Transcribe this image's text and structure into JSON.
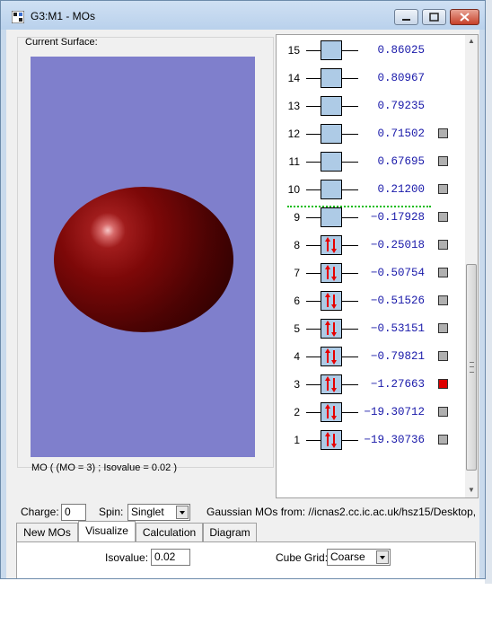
{
  "window": {
    "title": "G3:M1 - MOs"
  },
  "surface": {
    "label": "Current Surface:",
    "status": "MO ( (MO = 3) ; Isovalue = 0.02 )"
  },
  "orbitals": [
    {
      "num": "15",
      "energy": "0.86025",
      "occupied": false,
      "checkbox": false,
      "selected": false
    },
    {
      "num": "14",
      "energy": "0.80967",
      "occupied": false,
      "checkbox": false,
      "selected": false
    },
    {
      "num": "13",
      "energy": "0.79235",
      "occupied": false,
      "checkbox": false,
      "selected": false
    },
    {
      "num": "12",
      "energy": "0.71502",
      "occupied": false,
      "checkbox": true,
      "selected": false
    },
    {
      "num": "11",
      "energy": "0.67695",
      "occupied": false,
      "checkbox": true,
      "selected": false
    },
    {
      "num": "10",
      "energy": "0.21200",
      "occupied": false,
      "checkbox": true,
      "selected": false
    },
    {
      "num": "9",
      "energy": "−0.17928",
      "occupied": false,
      "checkbox": true,
      "selected": false
    },
    {
      "num": "8",
      "energy": "−0.25018",
      "occupied": true,
      "checkbox": true,
      "selected": false
    },
    {
      "num": "7",
      "energy": "−0.50754",
      "occupied": true,
      "checkbox": true,
      "selected": false
    },
    {
      "num": "6",
      "energy": "−0.51526",
      "occupied": true,
      "checkbox": true,
      "selected": false
    },
    {
      "num": "5",
      "energy": "−0.53151",
      "occupied": true,
      "checkbox": true,
      "selected": false
    },
    {
      "num": "4",
      "energy": "−0.79821",
      "occupied": true,
      "checkbox": true,
      "selected": false
    },
    {
      "num": "3",
      "energy": "−1.27663",
      "occupied": true,
      "checkbox": true,
      "selected": true
    },
    {
      "num": "2",
      "energy": "−19.30712",
      "occupied": true,
      "checkbox": true,
      "selected": false
    },
    {
      "num": "1",
      "energy": "−19.30736",
      "occupied": true,
      "checkbox": true,
      "selected": false
    }
  ],
  "controls": {
    "charge_label": "Charge:",
    "charge_value": "0",
    "spin_label": "Spin:",
    "spin_value": "Singlet",
    "source_text": "Gaussian MOs from:  //icnas2.cc.ic.ac.uk/hsz15/Desktop,"
  },
  "tabs": [
    "New MOs",
    "Visualize",
    "Calculation",
    "Diagram"
  ],
  "active_tab": "Visualize",
  "visualize": {
    "isovalue_label": "Isovalue:",
    "isovalue_value": "0.02",
    "cube_grid_label": "Cube Grid:",
    "cube_grid_value": "Coarse"
  },
  "colors": {
    "viewport_bg": "#7f7fcc",
    "orbital_box": "#aecbe6",
    "energy_text": "#1a1aaa",
    "homo_lumo_line": "#11bb11",
    "selected_check": "#dd0000"
  }
}
